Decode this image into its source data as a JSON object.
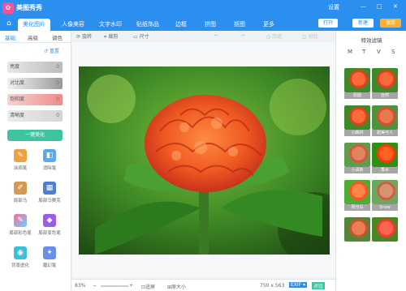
{
  "app": {
    "title": "美图秀秀",
    "window_controls": [
      "设置",
      "—",
      "□",
      "✕"
    ]
  },
  "nav": {
    "tabs": [
      "美化图片",
      "人像美容",
      "文字水印",
      "贴纸饰品",
      "边框",
      "拼图",
      "抠图",
      "更多"
    ],
    "active": 0,
    "open_label": "打开",
    "new_label": "新建",
    "save_label": "保存"
  },
  "left": {
    "tabs": [
      "基础",
      "高级",
      "调色"
    ],
    "active_tab": 0,
    "reset_label": "重置",
    "sliders": [
      {
        "label": "亮度",
        "value": "0"
      },
      {
        "label": "对比度",
        "value": "0"
      },
      {
        "label": "饱和度",
        "value": "0"
      },
      {
        "label": "清晰度",
        "value": "0"
      }
    ],
    "onekey_label": "一键美化",
    "tools": [
      {
        "label": "涂鸦笔",
        "icon": "pen-icon"
      },
      {
        "label": "消除笔",
        "icon": "eraser-icon"
      },
      {
        "label": "局部马",
        "icon": "brush-icon"
      },
      {
        "label": "局部马赛克",
        "icon": "mosaic-icon"
      },
      {
        "label": "局部彩色笔",
        "icon": "color-pen-icon"
      },
      {
        "label": "局部变色笔",
        "icon": "change-color-icon"
      },
      {
        "label": "背景虚化",
        "icon": "blur-icon"
      },
      {
        "label": "魔幻笔",
        "icon": "magic-pen-icon"
      }
    ]
  },
  "toolbar": {
    "rotate": "旋转",
    "crop": "裁剪",
    "resize": "尺寸",
    "undo": "",
    "redo": "",
    "history": "历史",
    "compare": "对比"
  },
  "bottom": {
    "zoom": "83%",
    "fit_label": "适屏",
    "actual_label": "原大小",
    "dimensions": "750 x 563",
    "exif_label": "EXIF ▾",
    "contrast_label": "对比"
  },
  "right": {
    "title": "特效滤镜",
    "tabs": [
      "M",
      "T",
      "V",
      "S"
    ],
    "filters": [
      {
        "label": "原图"
      },
      {
        "label": "自然"
      },
      {
        "label": "小森林"
      },
      {
        "label": "甜美可人"
      },
      {
        "label": "小清新"
      },
      {
        "label": "香水"
      },
      {
        "label": "阳光白"
      },
      {
        "label": "Snow"
      },
      {
        "label": ""
      },
      {
        "label": ""
      }
    ]
  },
  "colors": {
    "brand": "#2b8ff0",
    "onekey": "#3ec3a0"
  }
}
